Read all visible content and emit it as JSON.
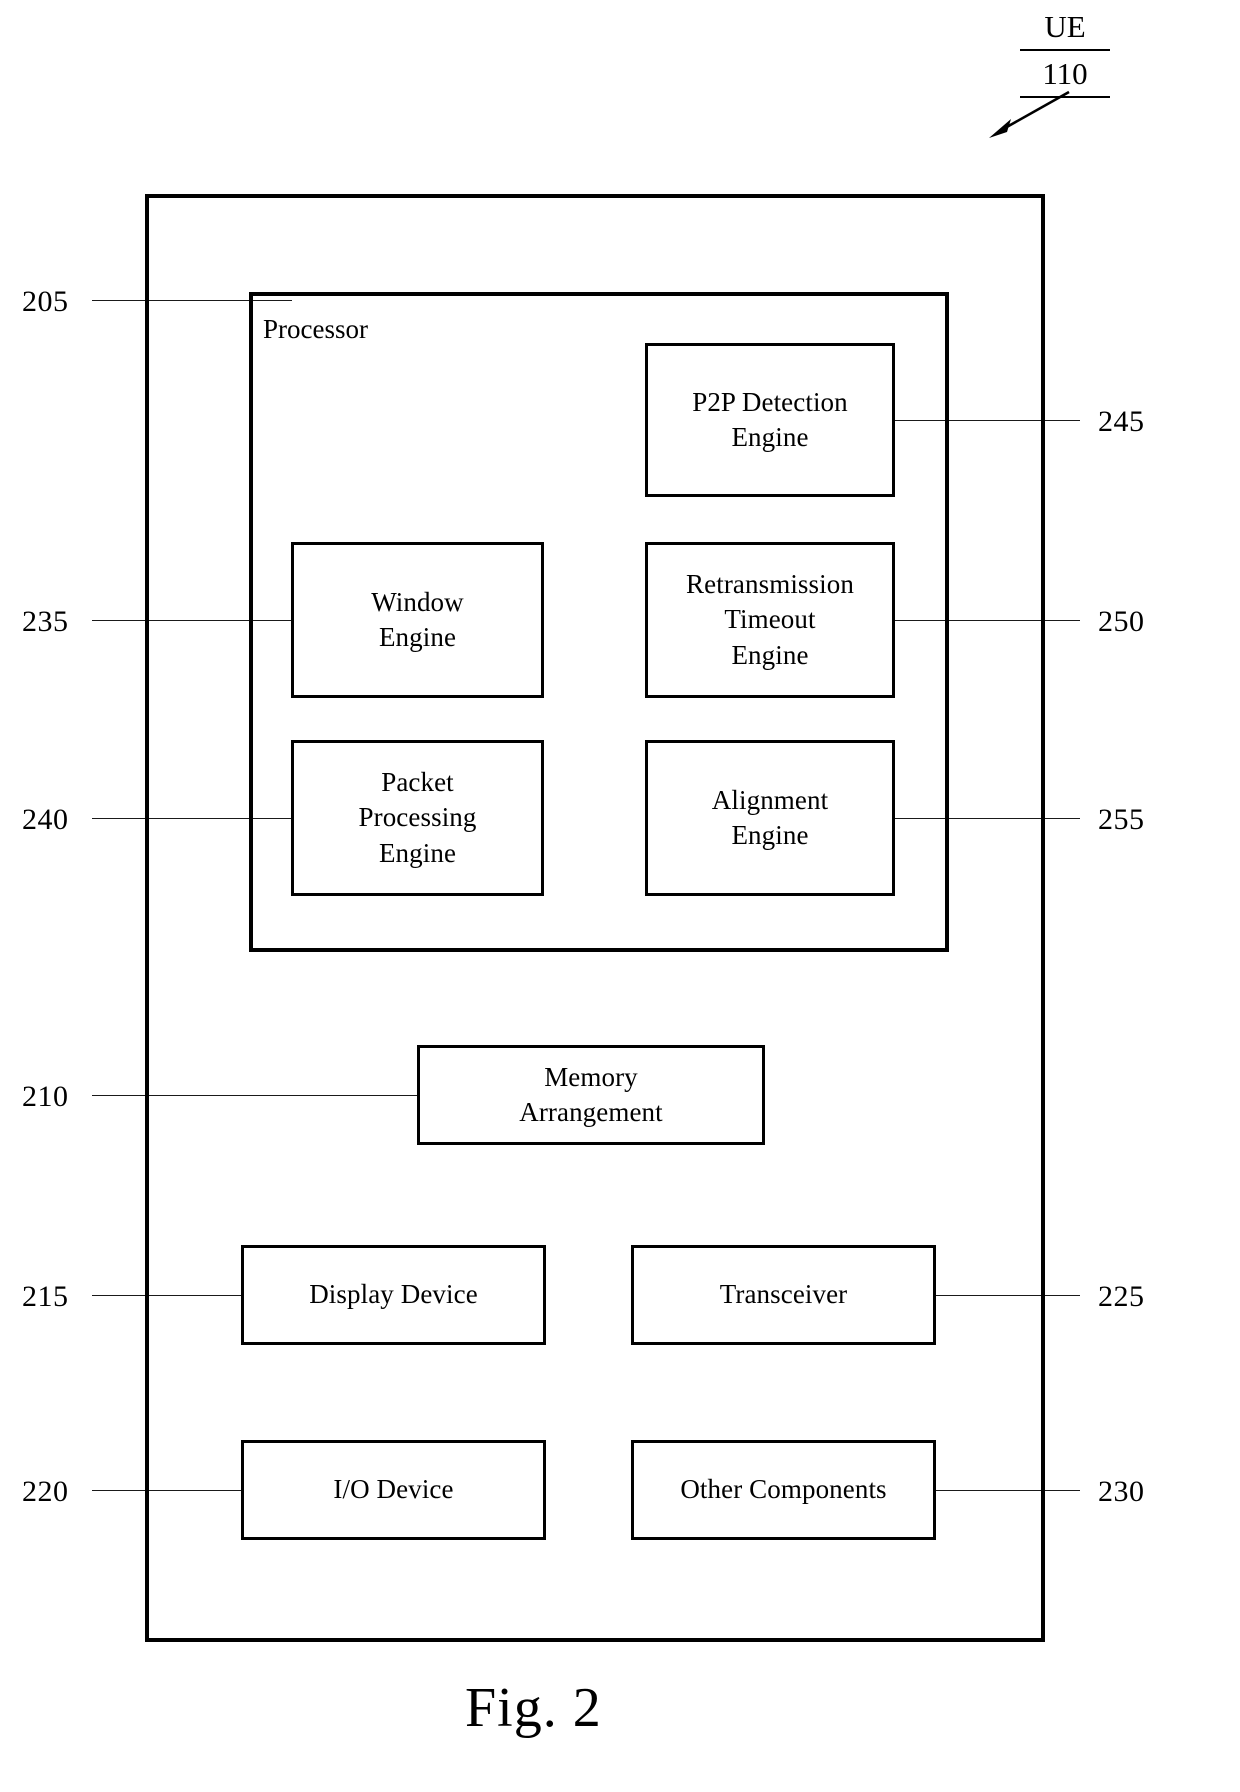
{
  "figure": {
    "caption": "Fig. 2",
    "callout": {
      "entity_label": "UE",
      "entity_ref": "110",
      "arrow_icon": "diagonal-arrow-down-left-icon"
    }
  },
  "device": {
    "ref": "",
    "processor": {
      "ref": "205",
      "label": "Processor",
      "engines": [
        {
          "ref": "245",
          "label": "P2P Detection\nEngine",
          "side": "right"
        },
        {
          "ref": "235",
          "label": "Window\nEngine",
          "side": "left"
        },
        {
          "ref": "250",
          "label": "Retransmission\nTimeout\nEngine",
          "side": "right"
        },
        {
          "ref": "240",
          "label": "Packet\nProcessing\nEngine",
          "side": "left"
        },
        {
          "ref": "255",
          "label": "Alignment\nEngine",
          "side": "right"
        }
      ]
    },
    "components": [
      {
        "ref": "210",
        "label": "Memory\nArrangement",
        "side": "left"
      },
      {
        "ref": "215",
        "label": "Display Device",
        "side": "left"
      },
      {
        "ref": "225",
        "label": "Transceiver",
        "side": "right"
      },
      {
        "ref": "220",
        "label": "I/O Device",
        "side": "left"
      },
      {
        "ref": "230",
        "label": "Other Components",
        "side": "right"
      }
    ]
  },
  "colors": {
    "ink": "#000000",
    "paper": "#ffffff",
    "leader_line": "#1a1a1a"
  }
}
